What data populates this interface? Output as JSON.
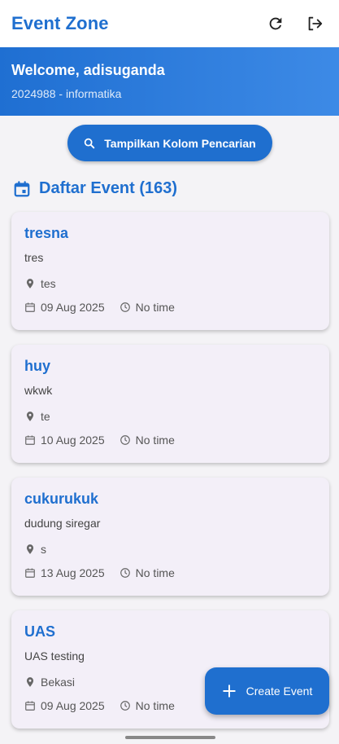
{
  "appbar": {
    "title": "Event Zone",
    "icons": [
      "refresh-icon",
      "logout-icon"
    ]
  },
  "welcome": {
    "title": "Welcome, adisuganda",
    "subtitle": "2024988 - informatika"
  },
  "search_button": {
    "label": "Tampilkan Kolom Pencarian",
    "icon": "search-icon"
  },
  "section": {
    "title": "Daftar Event (163)",
    "icon": "calendar-icon"
  },
  "events": [
    {
      "name": "tresna",
      "description": "tres",
      "location": "tes",
      "date": "09 Aug 2025",
      "time": "No time"
    },
    {
      "name": "huy",
      "description": "wkwk",
      "location": "te",
      "date": "10 Aug 2025",
      "time": "No time"
    },
    {
      "name": "cukurukuk",
      "description": "dudung siregar",
      "location": "s",
      "date": "13 Aug 2025",
      "time": "No time"
    },
    {
      "name": "UAS",
      "description": "UAS testing",
      "location": "Bekasi",
      "date": "09 Aug 2025",
      "time": "No time"
    }
  ],
  "fab": {
    "label": "Create Event",
    "icon": "plus-icon"
  },
  "colors": {
    "primary": "#1f6fcf",
    "card_bg": "#f3eff8",
    "page_bg": "#f4f3f6"
  }
}
